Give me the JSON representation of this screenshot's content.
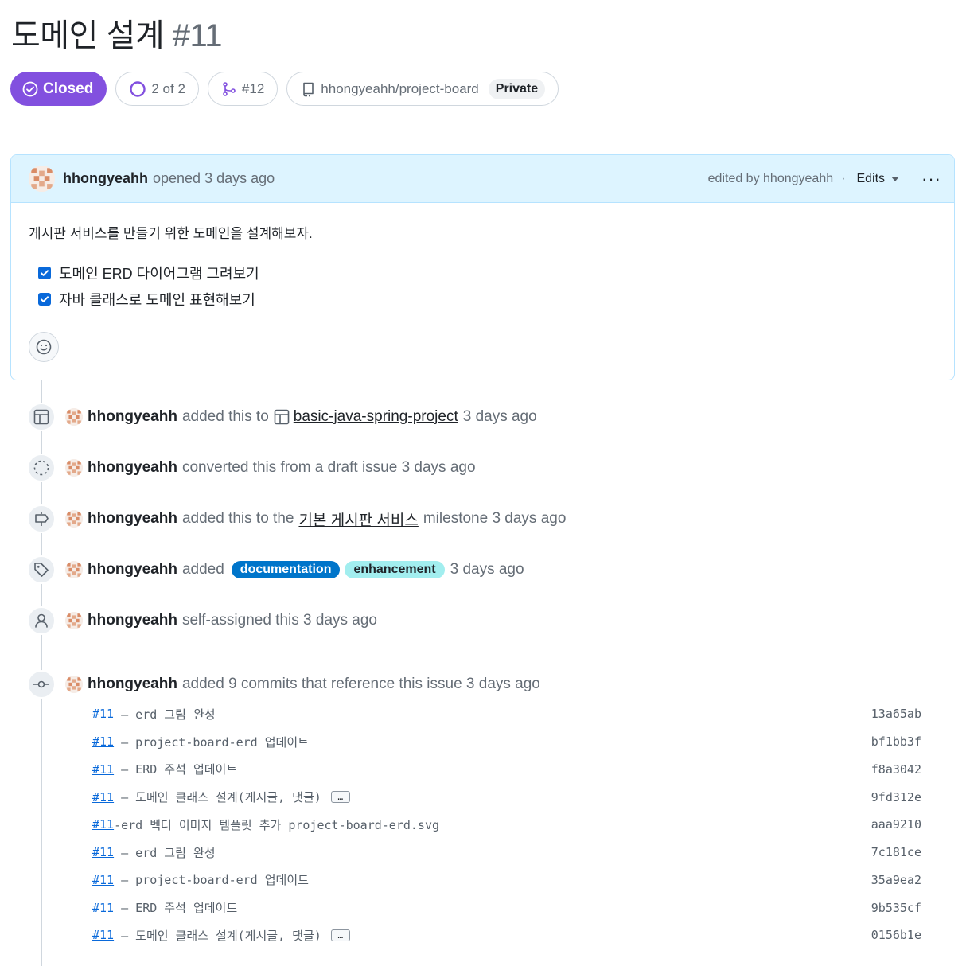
{
  "issue": {
    "title": "도메인 설계",
    "number": "#11"
  },
  "header": {
    "state": "Closed",
    "tasks": "2 of 2",
    "linked_pr": "#12",
    "repo": "hhongyeahh/project-board",
    "visibility": "Private"
  },
  "comment": {
    "author": "hhongyeahh",
    "action": "opened 3 days ago",
    "edited_by": "edited by hhongyeahh",
    "separator": "·",
    "edits_label": "Edits",
    "more": "···",
    "body": "게시판 서비스를 만들기 위한 도메인을 설계해보자.",
    "tasks": [
      {
        "label": "도메인 ERD 다이어그램 그려보기",
        "checked": true
      },
      {
        "label": "자바 클래스로 도메인 표현해보기",
        "checked": true
      }
    ]
  },
  "events": {
    "project": {
      "author": "hhongyeahh",
      "pre": "added this to",
      "link": "basic-java-spring-project",
      "post": "3 days ago",
      "icon": "table-icon"
    },
    "converted": {
      "author": "hhongyeahh",
      "text": "converted this from a draft issue 3 days ago",
      "icon": "draft-circle-icon"
    },
    "milestone": {
      "author": "hhongyeahh",
      "pre": "added this to the",
      "link": "기본 게시판 서비스",
      "post": "milestone 3 days ago",
      "icon": "milestone-icon"
    },
    "labels": {
      "author": "hhongyeahh",
      "pre": "added",
      "labels": [
        "documentation",
        "enhancement"
      ],
      "post": "3 days ago",
      "icon": "tag-icon"
    },
    "assigned": {
      "author": "hhongyeahh",
      "text": "self-assigned this 3 days ago",
      "icon": "person-icon"
    },
    "commits": {
      "author": "hhongyeahh",
      "text": "added 9 commits that reference this issue 3 days ago",
      "icon": "commit-icon"
    }
  },
  "commits": [
    {
      "ref": "#11",
      "msg": " – erd 그림 완성",
      "more": false,
      "sha": "13a65ab"
    },
    {
      "ref": "#11",
      "msg": " – project-board-erd 업데이트",
      "more": false,
      "sha": "bf1bb3f"
    },
    {
      "ref": "#11",
      "msg": " – ERD 주석 업데이트",
      "more": false,
      "sha": "f8a3042"
    },
    {
      "ref": "#11",
      "msg": " – 도메인 클래스 설계(게시글, 댓글)",
      "more": true,
      "sha": "9fd312e"
    },
    {
      "ref": "#11",
      "msg": "-erd 벡터 이미지 템플릿 추가 project-board-erd.svg",
      "more": false,
      "sha": "aaa9210"
    },
    {
      "ref": "#11",
      "msg": " – erd 그림 완성",
      "more": false,
      "sha": "7c181ce"
    },
    {
      "ref": "#11",
      "msg": " – project-board-erd 업데이트",
      "more": false,
      "sha": "35a9ea2"
    },
    {
      "ref": "#11",
      "msg": " – ERD 주석 업데이트",
      "more": false,
      "sha": "9b535cf"
    },
    {
      "ref": "#11",
      "msg": " – 도메인 클래스 설계(게시글, 댓글)",
      "more": true,
      "sha": "0156b1e"
    }
  ],
  "ellipsis_label": "…",
  "colors": {
    "closed": "#8250df",
    "link": "#0969da",
    "label_documentation": "#0075ca",
    "label_enhancement": "#a2eeef",
    "comment_header": "#ddf4ff"
  }
}
